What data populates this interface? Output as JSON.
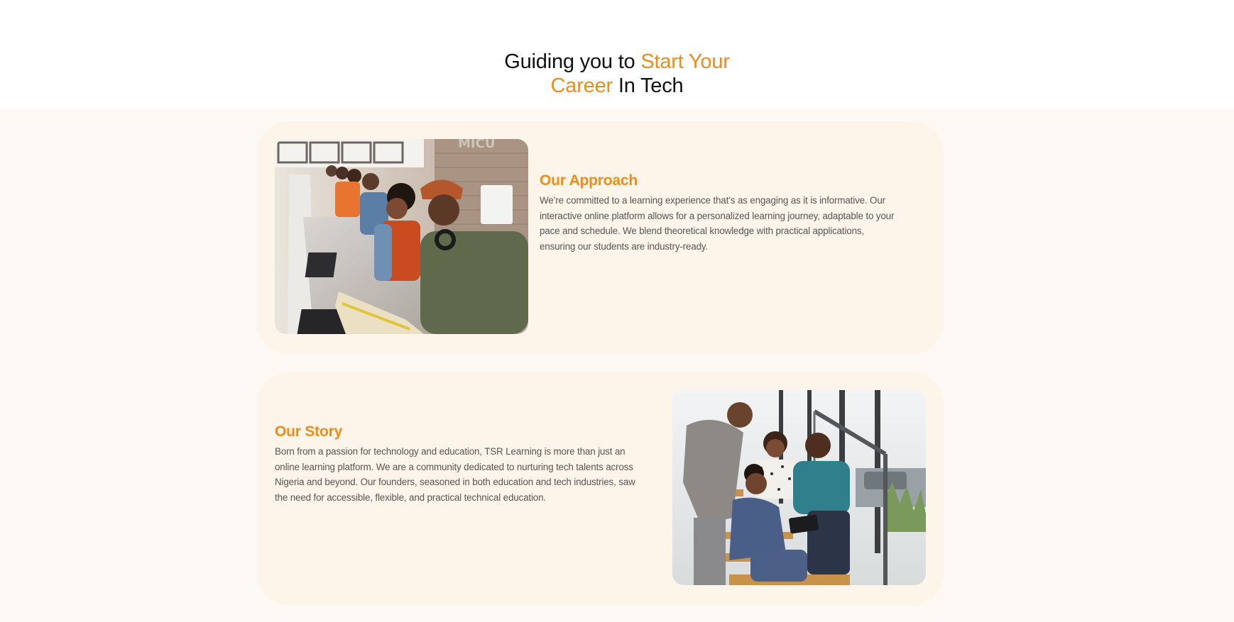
{
  "hero": {
    "title_part1": "Guiding you to ",
    "title_accent1": "Start Your",
    "title_accent2": "Career",
    "title_part2": " In Tech"
  },
  "approach": {
    "heading": "Our Approach",
    "body": "We’re committed to a learning experience that’s as engaging as it is informative. Our interactive online platform allows for a personalized learning journey, adaptable to your pace and schedule. We blend theoretical knowledge with practical applications, ensuring our students are industry-ready."
  },
  "story": {
    "heading": "Our Story",
    "body": "Born from a passion for technology and education, TSR Learning is more than just an online learning platform. We are a community dedicated to nurturing tech talents across Nigeria and beyond. Our founders, seasoned in both education and tech industries, saw the need for accessible, flexible, and practical technical education."
  },
  "colors": {
    "accent": "#f08c1a",
    "band": "#fcf9f4",
    "card": "#fef5ea",
    "body_text": "#555555"
  }
}
